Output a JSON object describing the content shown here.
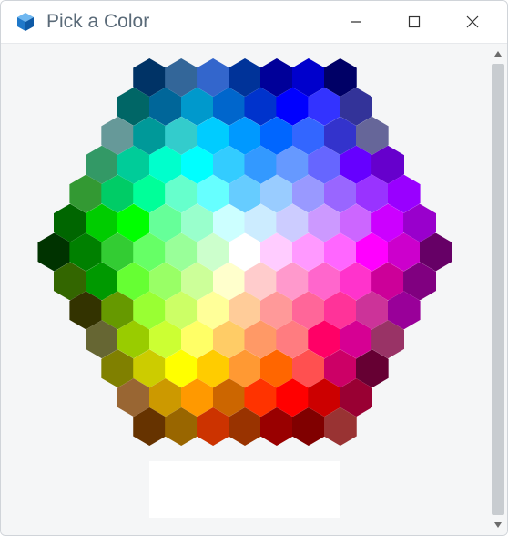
{
  "titlebar": {
    "app_name": "Pick a Color",
    "icon_name": "sketchup-icon"
  },
  "picker": {
    "selected_color": "#FFFFFF",
    "cell_radius_rings": 7,
    "rows": [
      [
        "#003366",
        "#336699",
        "#3366CC",
        "#003399",
        "#000099",
        "#0000CC",
        "#000066"
      ],
      [
        "#006666",
        "#006699",
        "#0099CC",
        "#0066CC",
        "#0033CC",
        "#0000FF",
        "#3333FF",
        "#333399"
      ],
      [
        "#669999",
        "#009999",
        "#33CCCC",
        "#00CCFF",
        "#0099FF",
        "#0066FF",
        "#3366FF",
        "#3333CC",
        "#666699"
      ],
      [
        "#339966",
        "#00CC99",
        "#00FFCC",
        "#00FFFF",
        "#33CCFF",
        "#3399FF",
        "#6699FF",
        "#6666FF",
        "#6600FF",
        "#6600CC"
      ],
      [
        "#339933",
        "#00CC66",
        "#00FF99",
        "#66FFCC",
        "#66FFFF",
        "#66CCFF",
        "#99CCFF",
        "#9999FF",
        "#9966FF",
        "#9933FF",
        "#9900FF"
      ],
      [
        "#006600",
        "#00CC00",
        "#00FF00",
        "#66FF99",
        "#99FFCC",
        "#CCFFFF",
        "#CCECFF",
        "#CCCCFF",
        "#CC99FF",
        "#CC66FF",
        "#CC00FF",
        "#9900CC"
      ],
      [
        "#003300",
        "#008000",
        "#33CC33",
        "#66FF66",
        "#99FF99",
        "#CCFFCC",
        "#FFFFFF",
        "#FFCCFF",
        "#FF99FF",
        "#FF66FF",
        "#FF00FF",
        "#CC00CC",
        "#660066"
      ],
      [
        "#336600",
        "#009900",
        "#66FF33",
        "#99FF66",
        "#CCFF99",
        "#FFFFCC",
        "#FFCCCC",
        "#FF99CC",
        "#FF66CC",
        "#FF33CC",
        "#CC0099",
        "#800080"
      ],
      [
        "#333300",
        "#669900",
        "#99FF33",
        "#CCFF66",
        "#FFFF99",
        "#FFCC99",
        "#FF9999",
        "#FF6699",
        "#FF3399",
        "#CC3399",
        "#990099"
      ],
      [
        "#666633",
        "#99CC00",
        "#CCFF33",
        "#FFFF66",
        "#FFCC66",
        "#FF9966",
        "#FF7C80",
        "#FF0066",
        "#D60093",
        "#993366"
      ],
      [
        "#808000",
        "#CCCC00",
        "#FFFF00",
        "#FFCC00",
        "#FF9933",
        "#FF6600",
        "#FF5050",
        "#CC0066",
        "#660033"
      ],
      [
        "#996633",
        "#CC9900",
        "#FF9900",
        "#CC6600",
        "#FF3300",
        "#FF0000",
        "#CC0000",
        "#990033"
      ],
      [
        "#663300",
        "#996600",
        "#CC3300",
        "#993300",
        "#990000",
        "#800000",
        "#993333"
      ]
    ]
  }
}
